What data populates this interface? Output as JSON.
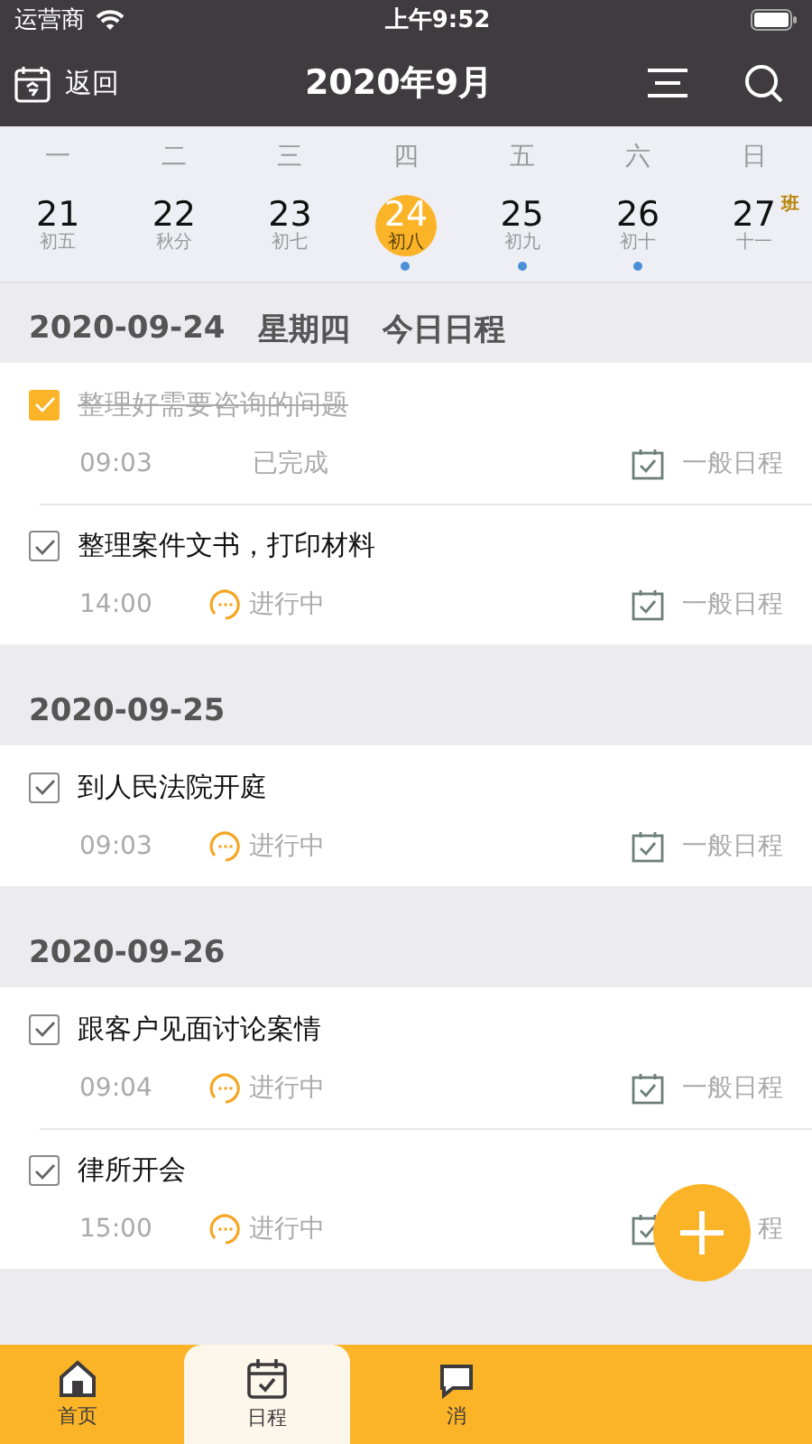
{
  "status_bar": {
    "carrier": "运营商",
    "time": "上午9:52"
  },
  "nav": {
    "back": "返回",
    "title": "2020年9月"
  },
  "week": {
    "weekdays": [
      "一",
      "二",
      "三",
      "四",
      "五",
      "六",
      "日"
    ],
    "days": [
      {
        "day": "21",
        "lunar": "初五",
        "selected": false,
        "has_event": false
      },
      {
        "day": "22",
        "lunar": "秋分",
        "selected": false,
        "has_event": false
      },
      {
        "day": "23",
        "lunar": "初七",
        "selected": false,
        "has_event": false
      },
      {
        "day": "24",
        "lunar": "初八",
        "selected": true,
        "has_event": true
      },
      {
        "day": "25",
        "lunar": "初九",
        "selected": false,
        "has_event": true
      },
      {
        "day": "26",
        "lunar": "初十",
        "selected": false,
        "has_event": true
      },
      {
        "day": "27",
        "lunar": "十一",
        "selected": false,
        "has_event": false,
        "badge": "班"
      }
    ]
  },
  "sections": [
    {
      "date": "2020-09-24",
      "weekday": "星期四",
      "label": "今日日程",
      "tasks": [
        {
          "title": "整理好需要咨询的问题",
          "time": "09:03",
          "status": "已完成",
          "checked": true,
          "done": true,
          "type": "一般日程"
        },
        {
          "title": "整理案件文书，打印材料",
          "time": "14:00",
          "status": "进行中",
          "checked": true,
          "done": false,
          "type": "一般日程"
        }
      ]
    },
    {
      "date": "2020-09-25",
      "tasks": [
        {
          "title": "到人民法院开庭",
          "time": "09:03",
          "status": "进行中",
          "checked": true,
          "done": false,
          "type": "一般日程"
        }
      ]
    },
    {
      "date": "2020-09-26",
      "tasks": [
        {
          "title": "跟客户见面讨论案情",
          "time": "09:04",
          "status": "进行中",
          "checked": true,
          "done": false,
          "type": "一般日程"
        },
        {
          "title": "律所开会",
          "time": "15:00",
          "status": "进行中",
          "checked": true,
          "done": false,
          "type": "程"
        }
      ]
    }
  ],
  "tab_bar": [
    {
      "label": "首页",
      "kind": "home",
      "selected": false
    },
    {
      "label": "日程",
      "kind": "calendar",
      "selected": true
    },
    {
      "label": "消",
      "kind": "message",
      "selected": false
    }
  ]
}
